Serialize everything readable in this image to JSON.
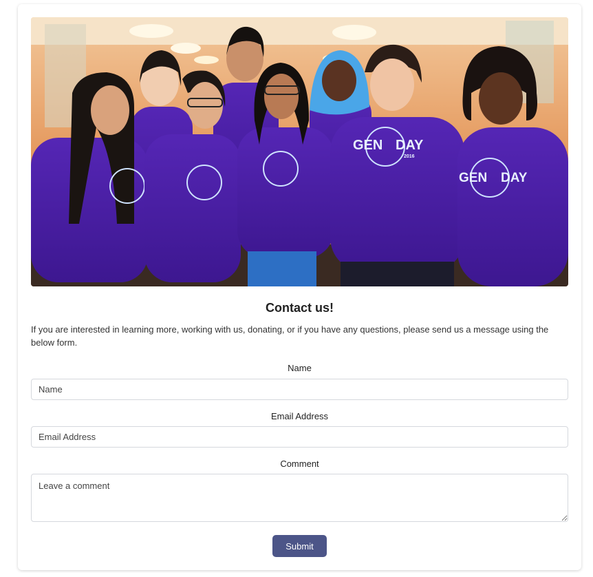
{
  "photo": {
    "alt": "Group of volunteers in purple GEN DAY 2016 t-shirts",
    "shirt_text_left": "GEN",
    "shirt_text_right": "DAY",
    "shirt_year": "2016"
  },
  "contact": {
    "title": "Contact us!",
    "intro": "If you are interested in learning more, working with us, donating, or if you have any questions, please send us a message using the below form."
  },
  "form": {
    "name_label": "Name",
    "name_placeholder": "Name",
    "email_label": "Email Address",
    "email_placeholder": "Email Address",
    "comment_label": "Comment",
    "comment_placeholder": "Leave a comment",
    "submit_label": "Submit"
  },
  "colors": {
    "submit_bg": "#4c5588",
    "shirt_purple": "#4b1fa3",
    "wall_orange": "#e3935a"
  }
}
